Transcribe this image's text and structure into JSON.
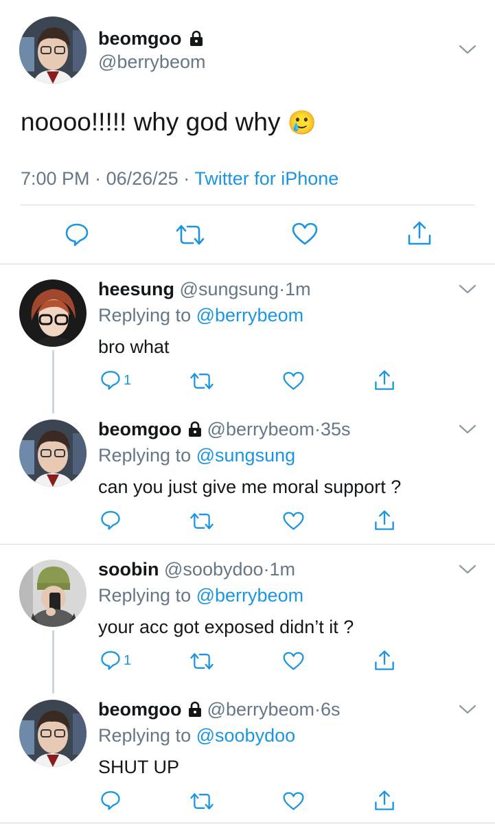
{
  "main_tweet": {
    "display_name": "beomgoo",
    "handle": "@berrybeom",
    "text": "noooo!!!!! why god why",
    "emoji": "🥲",
    "time": "7:00 PM",
    "date": "06/26/25",
    "separator": "·",
    "source": "Twitter for iPhone"
  },
  "replies": [
    {
      "display_name": "heesung",
      "handle": "@sungsung",
      "age": "1m",
      "reply_prefix": "Replying to",
      "reply_to": "@berrybeom",
      "text": "bro what",
      "reply_count": "1",
      "locked": false
    },
    {
      "display_name": "beomgoo",
      "handle": "@berrybeom",
      "age": "35s",
      "reply_prefix": "Replying to",
      "reply_to": "@sungsung",
      "text": "can you just give me moral support ?",
      "reply_count": "",
      "locked": true
    },
    {
      "display_name": "soobin",
      "handle": "@soobydoo",
      "age": "1m",
      "reply_prefix": "Replying to",
      "reply_to": "@berrybeom",
      "text": "your acc got exposed didn’t it ?",
      "reply_count": "1",
      "locked": false
    },
    {
      "display_name": "beomgoo",
      "handle": "@berrybeom",
      "age": "6s",
      "reply_prefix": "Replying to",
      "reply_to": "@soobydoo",
      "text": "SHUT UP",
      "reply_count": "",
      "locked": true
    }
  ],
  "colors": {
    "link": "#1b95e0",
    "secondary": "#657786",
    "icon": "#1b95e0",
    "divider": "#d3d9de"
  }
}
